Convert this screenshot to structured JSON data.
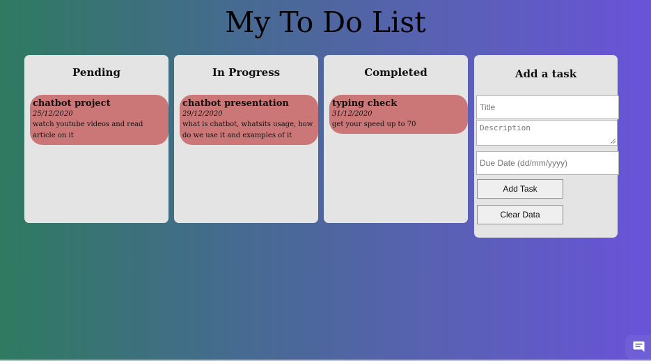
{
  "page_title": "My To Do List",
  "columns": [
    {
      "heading": "Pending",
      "tasks": [
        {
          "title": "chatbot project",
          "date": "25/12/2020",
          "description": "watch youtube videos and read article on it"
        }
      ]
    },
    {
      "heading": "In Progress",
      "tasks": [
        {
          "title": "chatbot presentation",
          "date": "29/12/2020",
          "description": "what is chatbot, whatsits usage, how do we use it and examples of it"
        }
      ]
    },
    {
      "heading": "Completed",
      "tasks": [
        {
          "title": "typing check",
          "date": "31/12/2020",
          "description": "get your speed up to 70"
        }
      ]
    }
  ],
  "add_task": {
    "heading": "Add a task",
    "title_placeholder": "Title",
    "description_placeholder": "Description",
    "due_date_placeholder": "Due Date (dd/mm/yyyy)",
    "add_button": "Add Task",
    "clear_button": "Clear Data"
  },
  "chat_widget": {
    "icon": "chat-icon",
    "color": "#6f5fd6"
  }
}
